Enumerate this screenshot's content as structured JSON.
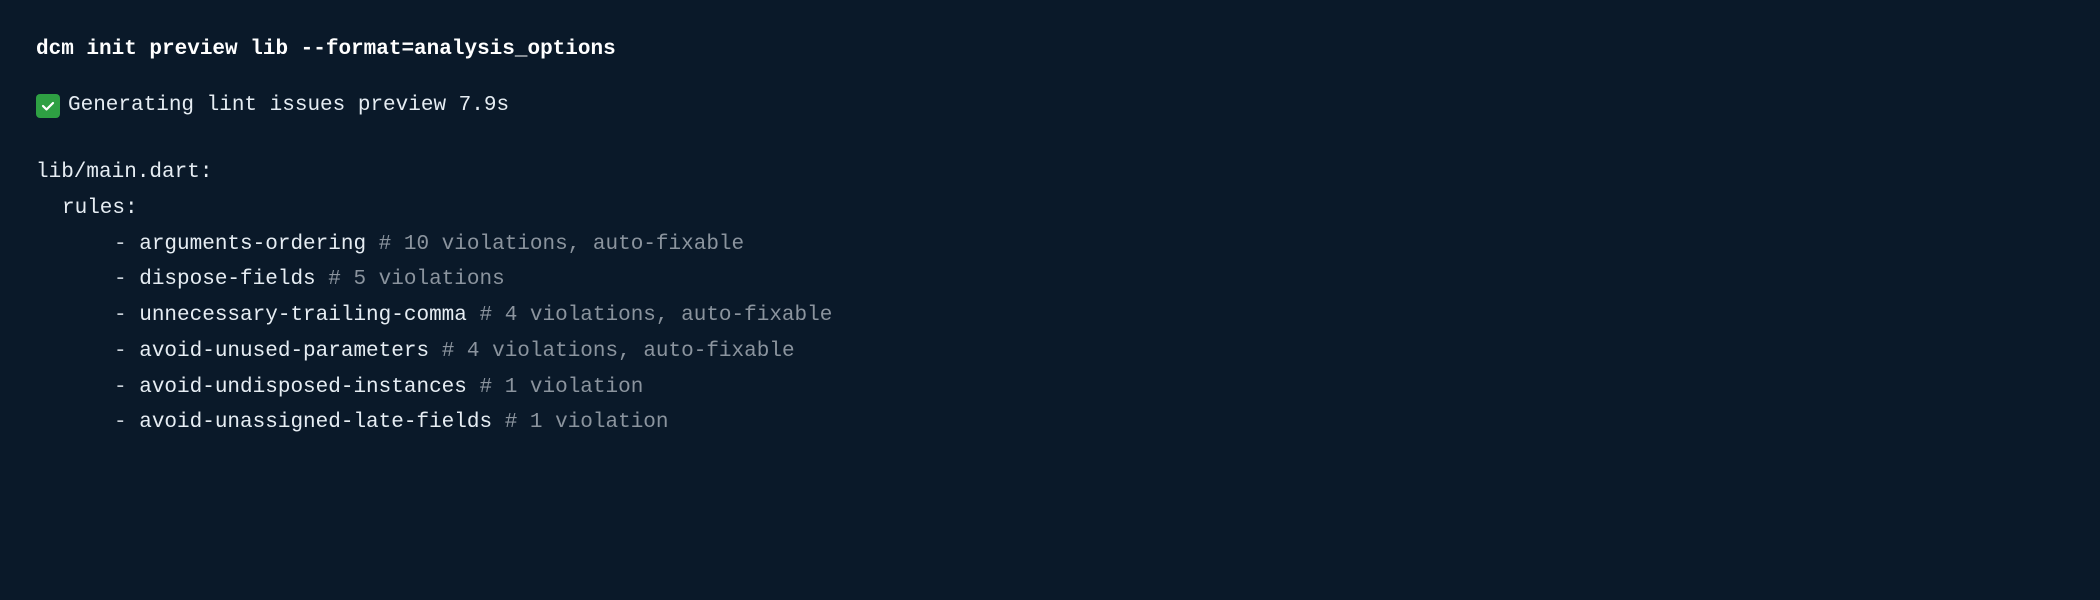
{
  "command": "dcm init preview lib --format=analysis_options",
  "status": {
    "text": "Generating lint issues preview 7.9s"
  },
  "file": "lib/main.dart:",
  "rules_label": "rules:",
  "rules": [
    {
      "name": "arguments-ordering",
      "comment": "# 10 violations, auto-fixable"
    },
    {
      "name": "dispose-fields",
      "comment": "# 5 violations"
    },
    {
      "name": "unnecessary-trailing-comma",
      "comment": "# 4 violations, auto-fixable"
    },
    {
      "name": "avoid-unused-parameters",
      "comment": "# 4 violations, auto-fixable"
    },
    {
      "name": "avoid-undisposed-instances",
      "comment": "# 1 violation"
    },
    {
      "name": "avoid-unassigned-late-fields",
      "comment": "# 1 violation"
    }
  ]
}
